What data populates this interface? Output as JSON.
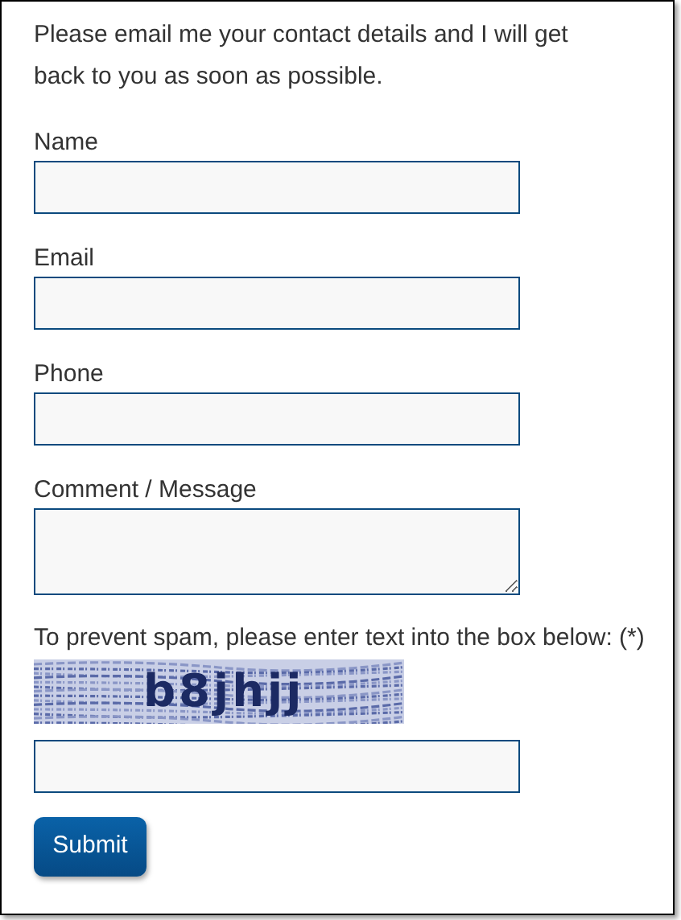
{
  "intro": "Please email me your contact details and I will get back to you as soon as possible.",
  "fields": [
    {
      "label": "Name",
      "kind": "input"
    },
    {
      "label": "Email",
      "kind": "input"
    },
    {
      "label": "Phone",
      "kind": "input"
    },
    {
      "label": "Comment / Message",
      "kind": "textarea"
    }
  ],
  "spam_prompt": "To prevent spam, please enter text into the box below: (*)",
  "captcha": {
    "text": "b8jhjj"
  },
  "submit": "Submit"
}
